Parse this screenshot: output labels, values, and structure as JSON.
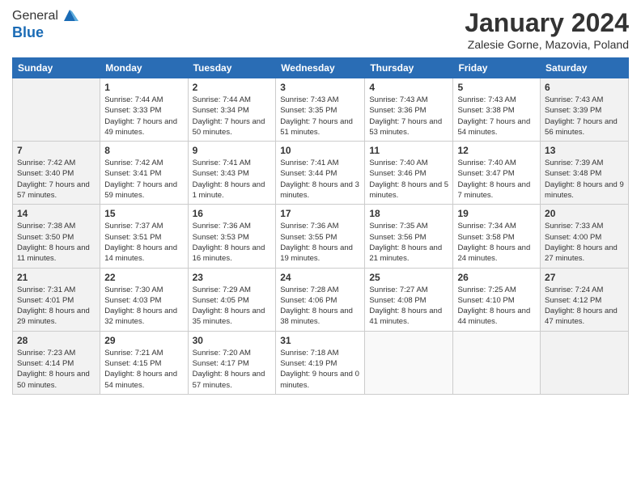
{
  "logo": {
    "line1": "General",
    "line2": "Blue"
  },
  "title": "January 2024",
  "location": "Zalesie Gorne, Mazovia, Poland",
  "columns": [
    "Sunday",
    "Monday",
    "Tuesday",
    "Wednesday",
    "Thursday",
    "Friday",
    "Saturday"
  ],
  "weeks": [
    [
      {
        "day": "",
        "sunrise": "",
        "sunset": "",
        "daylight": ""
      },
      {
        "day": "1",
        "sunrise": "Sunrise: 7:44 AM",
        "sunset": "Sunset: 3:33 PM",
        "daylight": "Daylight: 7 hours and 49 minutes."
      },
      {
        "day": "2",
        "sunrise": "Sunrise: 7:44 AM",
        "sunset": "Sunset: 3:34 PM",
        "daylight": "Daylight: 7 hours and 50 minutes."
      },
      {
        "day": "3",
        "sunrise": "Sunrise: 7:43 AM",
        "sunset": "Sunset: 3:35 PM",
        "daylight": "Daylight: 7 hours and 51 minutes."
      },
      {
        "day": "4",
        "sunrise": "Sunrise: 7:43 AM",
        "sunset": "Sunset: 3:36 PM",
        "daylight": "Daylight: 7 hours and 53 minutes."
      },
      {
        "day": "5",
        "sunrise": "Sunrise: 7:43 AM",
        "sunset": "Sunset: 3:38 PM",
        "daylight": "Daylight: 7 hours and 54 minutes."
      },
      {
        "day": "6",
        "sunrise": "Sunrise: 7:43 AM",
        "sunset": "Sunset: 3:39 PM",
        "daylight": "Daylight: 7 hours and 56 minutes."
      }
    ],
    [
      {
        "day": "7",
        "sunrise": "Sunrise: 7:42 AM",
        "sunset": "Sunset: 3:40 PM",
        "daylight": "Daylight: 7 hours and 57 minutes."
      },
      {
        "day": "8",
        "sunrise": "Sunrise: 7:42 AM",
        "sunset": "Sunset: 3:41 PM",
        "daylight": "Daylight: 7 hours and 59 minutes."
      },
      {
        "day": "9",
        "sunrise": "Sunrise: 7:41 AM",
        "sunset": "Sunset: 3:43 PM",
        "daylight": "Daylight: 8 hours and 1 minute."
      },
      {
        "day": "10",
        "sunrise": "Sunrise: 7:41 AM",
        "sunset": "Sunset: 3:44 PM",
        "daylight": "Daylight: 8 hours and 3 minutes."
      },
      {
        "day": "11",
        "sunrise": "Sunrise: 7:40 AM",
        "sunset": "Sunset: 3:46 PM",
        "daylight": "Daylight: 8 hours and 5 minutes."
      },
      {
        "day": "12",
        "sunrise": "Sunrise: 7:40 AM",
        "sunset": "Sunset: 3:47 PM",
        "daylight": "Daylight: 8 hours and 7 minutes."
      },
      {
        "day": "13",
        "sunrise": "Sunrise: 7:39 AM",
        "sunset": "Sunset: 3:48 PM",
        "daylight": "Daylight: 8 hours and 9 minutes."
      }
    ],
    [
      {
        "day": "14",
        "sunrise": "Sunrise: 7:38 AM",
        "sunset": "Sunset: 3:50 PM",
        "daylight": "Daylight: 8 hours and 11 minutes."
      },
      {
        "day": "15",
        "sunrise": "Sunrise: 7:37 AM",
        "sunset": "Sunset: 3:51 PM",
        "daylight": "Daylight: 8 hours and 14 minutes."
      },
      {
        "day": "16",
        "sunrise": "Sunrise: 7:36 AM",
        "sunset": "Sunset: 3:53 PM",
        "daylight": "Daylight: 8 hours and 16 minutes."
      },
      {
        "day": "17",
        "sunrise": "Sunrise: 7:36 AM",
        "sunset": "Sunset: 3:55 PM",
        "daylight": "Daylight: 8 hours and 19 minutes."
      },
      {
        "day": "18",
        "sunrise": "Sunrise: 7:35 AM",
        "sunset": "Sunset: 3:56 PM",
        "daylight": "Daylight: 8 hours and 21 minutes."
      },
      {
        "day": "19",
        "sunrise": "Sunrise: 7:34 AM",
        "sunset": "Sunset: 3:58 PM",
        "daylight": "Daylight: 8 hours and 24 minutes."
      },
      {
        "day": "20",
        "sunrise": "Sunrise: 7:33 AM",
        "sunset": "Sunset: 4:00 PM",
        "daylight": "Daylight: 8 hours and 27 minutes."
      }
    ],
    [
      {
        "day": "21",
        "sunrise": "Sunrise: 7:31 AM",
        "sunset": "Sunset: 4:01 PM",
        "daylight": "Daylight: 8 hours and 29 minutes."
      },
      {
        "day": "22",
        "sunrise": "Sunrise: 7:30 AM",
        "sunset": "Sunset: 4:03 PM",
        "daylight": "Daylight: 8 hours and 32 minutes."
      },
      {
        "day": "23",
        "sunrise": "Sunrise: 7:29 AM",
        "sunset": "Sunset: 4:05 PM",
        "daylight": "Daylight: 8 hours and 35 minutes."
      },
      {
        "day": "24",
        "sunrise": "Sunrise: 7:28 AM",
        "sunset": "Sunset: 4:06 PM",
        "daylight": "Daylight: 8 hours and 38 minutes."
      },
      {
        "day": "25",
        "sunrise": "Sunrise: 7:27 AM",
        "sunset": "Sunset: 4:08 PM",
        "daylight": "Daylight: 8 hours and 41 minutes."
      },
      {
        "day": "26",
        "sunrise": "Sunrise: 7:25 AM",
        "sunset": "Sunset: 4:10 PM",
        "daylight": "Daylight: 8 hours and 44 minutes."
      },
      {
        "day": "27",
        "sunrise": "Sunrise: 7:24 AM",
        "sunset": "Sunset: 4:12 PM",
        "daylight": "Daylight: 8 hours and 47 minutes."
      }
    ],
    [
      {
        "day": "28",
        "sunrise": "Sunrise: 7:23 AM",
        "sunset": "Sunset: 4:14 PM",
        "daylight": "Daylight: 8 hours and 50 minutes."
      },
      {
        "day": "29",
        "sunrise": "Sunrise: 7:21 AM",
        "sunset": "Sunset: 4:15 PM",
        "daylight": "Daylight: 8 hours and 54 minutes."
      },
      {
        "day": "30",
        "sunrise": "Sunrise: 7:20 AM",
        "sunset": "Sunset: 4:17 PM",
        "daylight": "Daylight: 8 hours and 57 minutes."
      },
      {
        "day": "31",
        "sunrise": "Sunrise: 7:18 AM",
        "sunset": "Sunset: 4:19 PM",
        "daylight": "Daylight: 9 hours and 0 minutes."
      },
      {
        "day": "",
        "sunrise": "",
        "sunset": "",
        "daylight": ""
      },
      {
        "day": "",
        "sunrise": "",
        "sunset": "",
        "daylight": ""
      },
      {
        "day": "",
        "sunrise": "",
        "sunset": "",
        "daylight": ""
      }
    ]
  ]
}
